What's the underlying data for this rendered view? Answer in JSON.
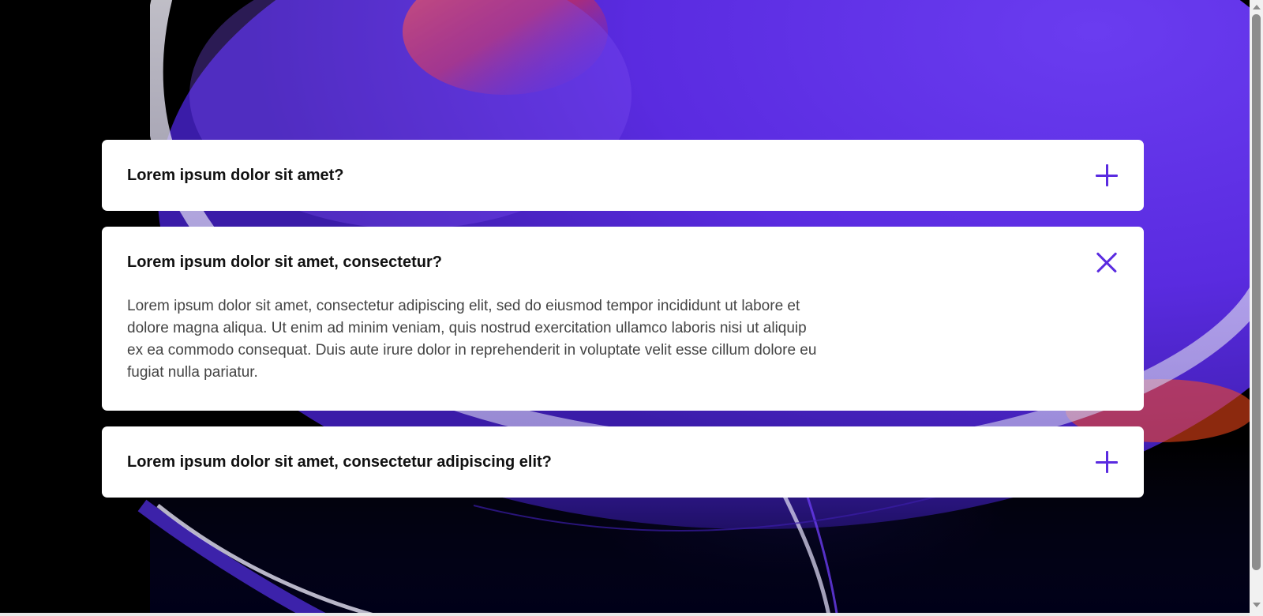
{
  "colors": {
    "accent": "#5a2be0",
    "card": "#ffffff",
    "background": "#000000"
  },
  "faq": {
    "items": [
      {
        "question": "Lorem ipsum dolor sit amet?",
        "expanded": false,
        "icon": "plus-icon"
      },
      {
        "question": "Lorem ipsum dolor sit amet, consectetur?",
        "expanded": true,
        "icon": "close-icon",
        "answer": "Lorem ipsum dolor sit amet, consectetur adipiscing elit, sed do eiusmod tempor incididunt ut labore et dolore magna aliqua. Ut enim ad minim veniam, quis nostrud exercitation ullamco laboris nisi ut aliquip ex ea commodo consequat. Duis aute irure dolor in reprehenderit in voluptate velit esse cillum dolore eu fugiat nulla pariatur."
      },
      {
        "question": "Lorem ipsum dolor sit amet, consectetur adipiscing elit?",
        "expanded": false,
        "icon": "plus-icon"
      }
    ]
  }
}
